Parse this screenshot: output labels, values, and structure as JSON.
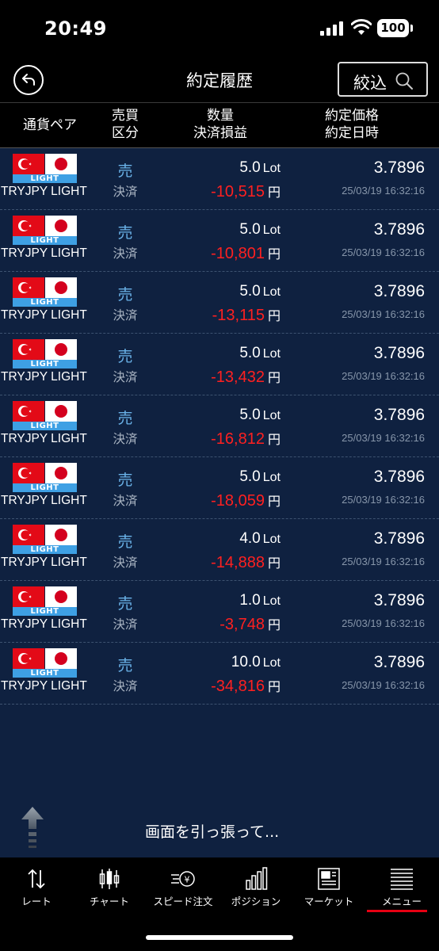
{
  "status_bar": {
    "time": "20:49",
    "battery": "100"
  },
  "header": {
    "title": "約定履歴",
    "filter_label": "絞込"
  },
  "columns": {
    "pair": "通貨ペア",
    "side_line1": "売買",
    "side_line2": "区分",
    "qty_line1": "数量",
    "qty_line2": "決済損益",
    "price_line1": "約定価格",
    "price_line2": "約定日時"
  },
  "rows": [
    {
      "flag_badge": "LIGHT",
      "pair": "TRYJPY LIGHT",
      "side": "売",
      "kind": "決済",
      "qty": "5.0",
      "unit": "Lot",
      "pnl": "-10,515",
      "currency": "円",
      "price": "3.7896",
      "datetime": "25/03/19 16:32:16"
    },
    {
      "flag_badge": "LIGHT",
      "pair": "TRYJPY LIGHT",
      "side": "売",
      "kind": "決済",
      "qty": "5.0",
      "unit": "Lot",
      "pnl": "-10,801",
      "currency": "円",
      "price": "3.7896",
      "datetime": "25/03/19 16:32:16"
    },
    {
      "flag_badge": "LIGHT",
      "pair": "TRYJPY LIGHT",
      "side": "売",
      "kind": "決済",
      "qty": "5.0",
      "unit": "Lot",
      "pnl": "-13,115",
      "currency": "円",
      "price": "3.7896",
      "datetime": "25/03/19 16:32:16"
    },
    {
      "flag_badge": "LIGHT",
      "pair": "TRYJPY LIGHT",
      "side": "売",
      "kind": "決済",
      "qty": "5.0",
      "unit": "Lot",
      "pnl": "-13,432",
      "currency": "円",
      "price": "3.7896",
      "datetime": "25/03/19 16:32:16"
    },
    {
      "flag_badge": "LIGHT",
      "pair": "TRYJPY LIGHT",
      "side": "売",
      "kind": "決済",
      "qty": "5.0",
      "unit": "Lot",
      "pnl": "-16,812",
      "currency": "円",
      "price": "3.7896",
      "datetime": "25/03/19 16:32:16"
    },
    {
      "flag_badge": "LIGHT",
      "pair": "TRYJPY LIGHT",
      "side": "売",
      "kind": "決済",
      "qty": "5.0",
      "unit": "Lot",
      "pnl": "-18,059",
      "currency": "円",
      "price": "3.7896",
      "datetime": "25/03/19 16:32:16"
    },
    {
      "flag_badge": "LIGHT",
      "pair": "TRYJPY LIGHT",
      "side": "売",
      "kind": "決済",
      "qty": "4.0",
      "unit": "Lot",
      "pnl": "-14,888",
      "currency": "円",
      "price": "3.7896",
      "datetime": "25/03/19 16:32:16"
    },
    {
      "flag_badge": "LIGHT",
      "pair": "TRYJPY LIGHT",
      "side": "売",
      "kind": "決済",
      "qty": "1.0",
      "unit": "Lot",
      "pnl": "-3,748",
      "currency": "円",
      "price": "3.7896",
      "datetime": "25/03/19 16:32:16"
    },
    {
      "flag_badge": "LIGHT",
      "pair": "TRYJPY LIGHT",
      "side": "売",
      "kind": "決済",
      "qty": "10.0",
      "unit": "Lot",
      "pnl": "-34,816",
      "currency": "円",
      "price": "3.7896",
      "datetime": "25/03/19 16:32:16"
    }
  ],
  "pull_to_refresh": "画面を引っ張って...",
  "tabs": [
    {
      "label": "レート",
      "icon": "rate-arrows-icon"
    },
    {
      "label": "チャート",
      "icon": "candlestick-icon"
    },
    {
      "label": "スピード注文",
      "icon": "speed-order-icon"
    },
    {
      "label": "ポジション",
      "icon": "position-bars-icon"
    },
    {
      "label": "マーケット",
      "icon": "newspaper-icon"
    },
    {
      "label": "メニュー",
      "icon": "menu-lines-icon"
    }
  ],
  "active_tab": "メニュー",
  "colors": {
    "background": "#0f2140",
    "sell": "#6ab2e8",
    "loss": "#ff2020",
    "active_tab_underline": "#e60012",
    "light_badge": "#3ea0e4"
  }
}
